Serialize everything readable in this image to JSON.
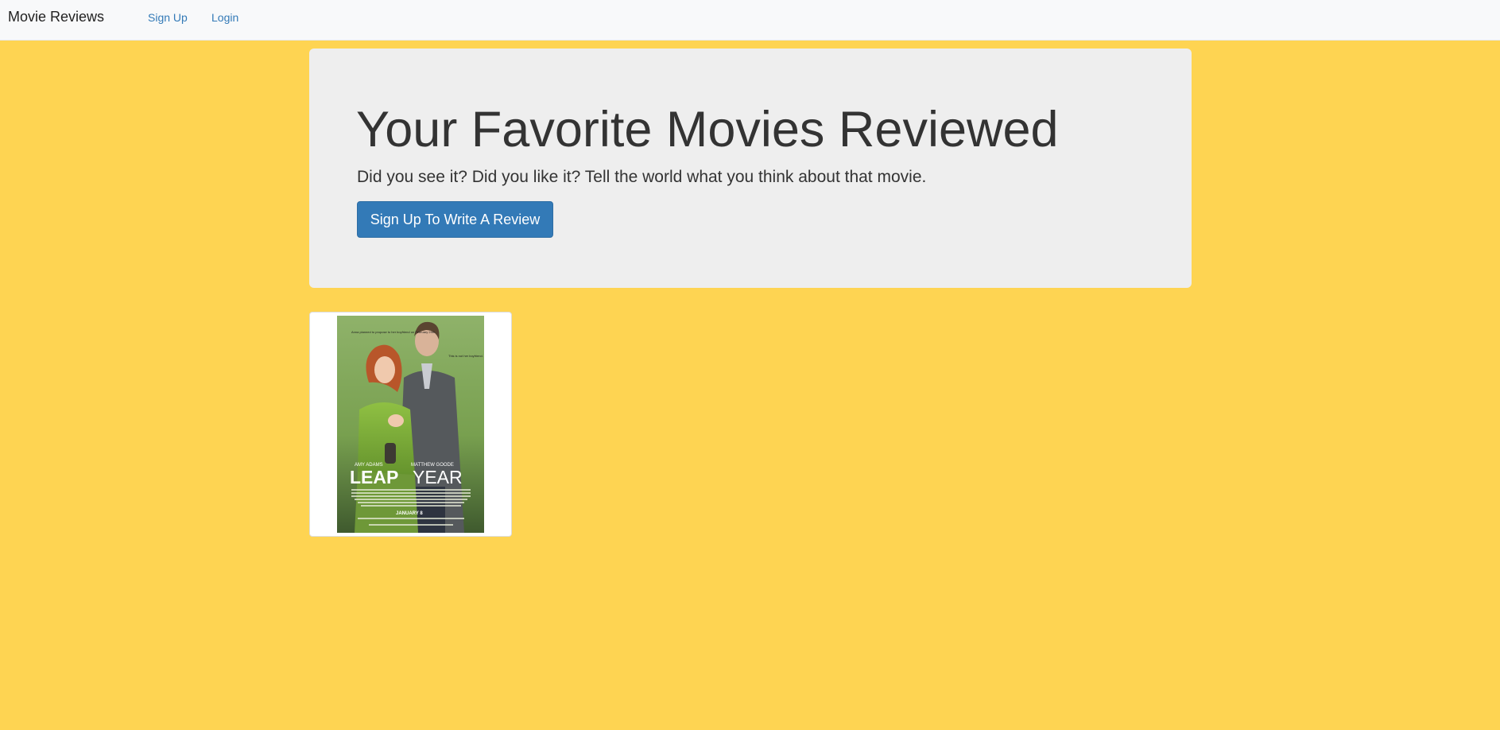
{
  "navbar": {
    "brand": "Movie Reviews",
    "links": [
      {
        "label": "Sign Up"
      },
      {
        "label": "Login"
      }
    ]
  },
  "hero": {
    "title": "Your Favorite Movies Reviewed",
    "lead": "Did you see it? Did you like it? Tell the world what you think about that movie.",
    "button_label": "Sign Up To Write A Review"
  },
  "movies": [
    {
      "poster": {
        "title_word_1": "LEAP",
        "title_word_2": "YEAR",
        "actor_1": "AMY ADAMS",
        "actor_2": "MATTHEW GOODE",
        "release": "JANUARY 8",
        "tagline_left": "Anna planned to propose to her boyfriend on February 29th.",
        "tagline_right": "This is not her boyfriend."
      }
    }
  ],
  "colors": {
    "page_background": "#fed452",
    "navbar_background": "#f8f9fa",
    "jumbotron_background": "#eeeeee",
    "primary_button": "#337ab7",
    "link": "#337ab7"
  }
}
